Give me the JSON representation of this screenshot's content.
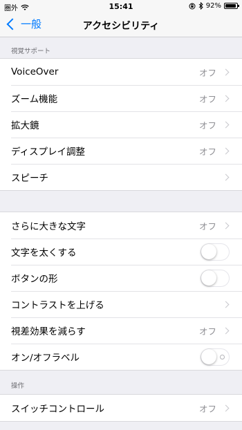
{
  "status_bar": {
    "carrier": "圏外",
    "time": "15:41",
    "battery": "92%",
    "battery_level": 0.92,
    "icons": [
      "wifi-icon",
      "orientation-lock-icon",
      "bluetooth-icon",
      "battery-icon"
    ]
  },
  "nav": {
    "back_label": "一般",
    "title": "アクセシビリティ"
  },
  "sections": {
    "vision": {
      "header": "視覚サポート",
      "rows": [
        {
          "label": "VoiceOver",
          "value": "オフ"
        },
        {
          "label": "ズーム機能",
          "value": "オフ"
        },
        {
          "label": "拡大鏡",
          "value": "オフ"
        },
        {
          "label": "ディスプレイ調整",
          "value": "オフ"
        },
        {
          "label": "スピーチ",
          "value": ""
        }
      ]
    },
    "display": {
      "rows": [
        {
          "label": "さらに大きな文字",
          "value": "オフ"
        },
        {
          "label": "文字を太くする",
          "toggle": false
        },
        {
          "label": "ボタンの形",
          "toggle": false
        },
        {
          "label": "コントラストを上げる",
          "value": ""
        },
        {
          "label": "視差効果を減らす",
          "value": "オフ"
        },
        {
          "label": "オン/オフラベル",
          "toggle": false
        }
      ]
    },
    "interaction": {
      "header": "操作",
      "rows": [
        {
          "label": "スイッチコントロール",
          "value": "オフ"
        }
      ]
    }
  },
  "colors": {
    "accent": "#007aff",
    "background": "#efeff4",
    "secondary_text": "#8e8e93"
  }
}
